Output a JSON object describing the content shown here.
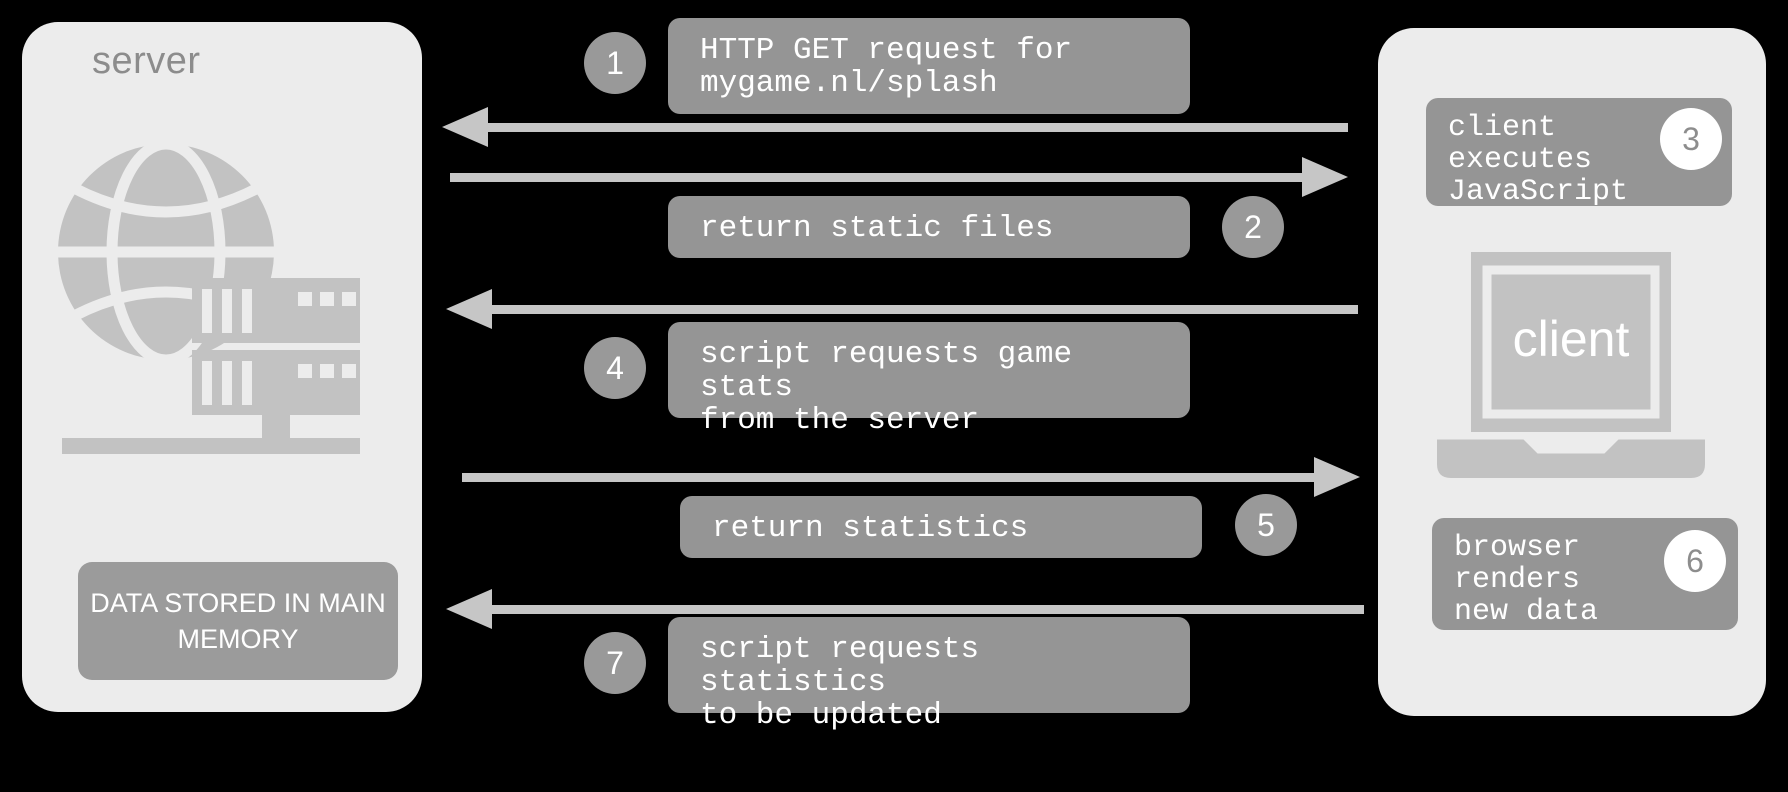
{
  "diagram": {
    "server": {
      "title": "server",
      "icon": "globe-server-icon",
      "data_store_label": "DATA STORED IN\nMAIN MEMORY"
    },
    "client": {
      "icon": "laptop-icon",
      "screen_label": "client",
      "notes": [
        {
          "step": "3",
          "text": "client\nexecutes\nJavaScript"
        },
        {
          "step": "6",
          "text": "browser\nrenders\nnew data"
        }
      ]
    },
    "messages": [
      {
        "step": "1",
        "text": "HTTP GET request for\nmygame.nl/splash",
        "direction": "to-server",
        "badge_side": "left"
      },
      {
        "step": "2",
        "text": "return static files",
        "direction": "to-client",
        "badge_side": "right"
      },
      {
        "step": "4",
        "text": "script requests game stats\nfrom the server",
        "direction": "to-server",
        "badge_side": "left"
      },
      {
        "step": "5",
        "text": "return statistics",
        "direction": "to-client",
        "badge_side": "right"
      },
      {
        "step": "7",
        "text": "script requests statistics\nto be updated",
        "direction": "to-server",
        "badge_side": "left"
      }
    ],
    "colors": {
      "background": "#000000",
      "panel": "#ececec",
      "box": "#959595",
      "arrow": "#c6c6c6",
      "icon": "#c2c2c2",
      "badge_gray": "#999999",
      "badge_white": "#ffffff",
      "title_text": "#8c8c8c"
    }
  }
}
